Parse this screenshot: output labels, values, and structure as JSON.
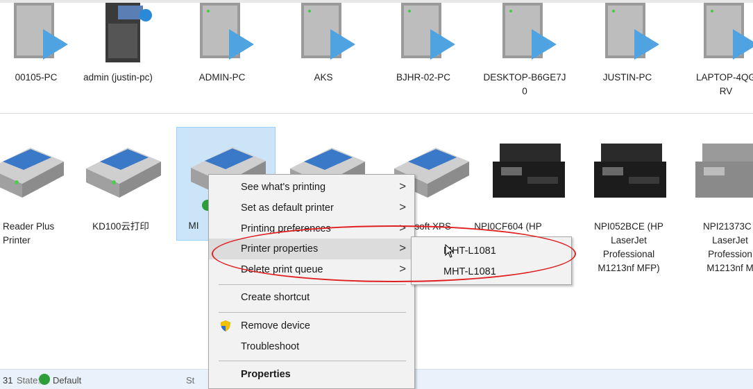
{
  "devices": [
    {
      "label": "00105-PC",
      "icon": "computer-icon"
    },
    {
      "label": "admin (justin-pc)",
      "icon": "computer-media-icon"
    },
    {
      "label": "ADMIN-PC",
      "icon": "computer-icon"
    },
    {
      "label": "AKS",
      "icon": "computer-icon"
    },
    {
      "label": "BJHR-02-PC",
      "icon": "computer-icon"
    },
    {
      "label": "DESKTOP-B6GE7J\n0",
      "icon": "computer-icon"
    },
    {
      "label": "JUSTIN-PC",
      "icon": "computer-icon"
    },
    {
      "label": "LAPTOP-4QG\nRV",
      "icon": "computer-icon"
    }
  ],
  "printers": [
    {
      "label": "Reader Plus\nPrinter",
      "icon": "printer-icon"
    },
    {
      "label": "KD100云打印",
      "icon": "printer-icon"
    },
    {
      "label": "MI",
      "icon": "printer-icon",
      "selected": true
    },
    {
      "label": "osoft XPS",
      "icon": "printer-icon"
    },
    {
      "label": "NPI0CF604 (HP",
      "icon": "printer-icon"
    },
    {
      "label": "NPI0CF604 (HP",
      "icon": "laserjet-printer-icon"
    },
    {
      "label": "NPI052BCE (HP\nLaserJet\nProfessional\nM1213nf MFP)",
      "icon": "laserjet-printer-icon"
    },
    {
      "label": "NPI21373C (\nLaserJet\nProfession\nM1213nf M",
      "icon": "laserjet-printer-icon"
    }
  ],
  "context_menu": {
    "items": [
      {
        "label": "See what's printing",
        "chevron": ">"
      },
      {
        "label": "Set as default printer",
        "chevron": ">"
      },
      {
        "label": "Printing preferences",
        "chevron": ">"
      },
      {
        "label": "Printer properties",
        "chevron": ">"
      },
      {
        "label": "Delete print queue",
        "chevron": ">"
      },
      {
        "label": "Create shortcut"
      },
      {
        "label": "Remove device",
        "icon": "shield-icon"
      },
      {
        "label": "Troubleshoot"
      },
      {
        "label": "Properties"
      }
    ]
  },
  "submenu": {
    "items": [
      "MHT-L1081",
      "MHT-L1081"
    ]
  },
  "status_bar": {
    "count": "31",
    "state_label": "State:",
    "state_value": "Default",
    "extra_label": "St"
  },
  "colors": {
    "selection_bg": "#cce4f7",
    "annotation_red": "#e02020",
    "status_green": "#2e9e3a"
  }
}
